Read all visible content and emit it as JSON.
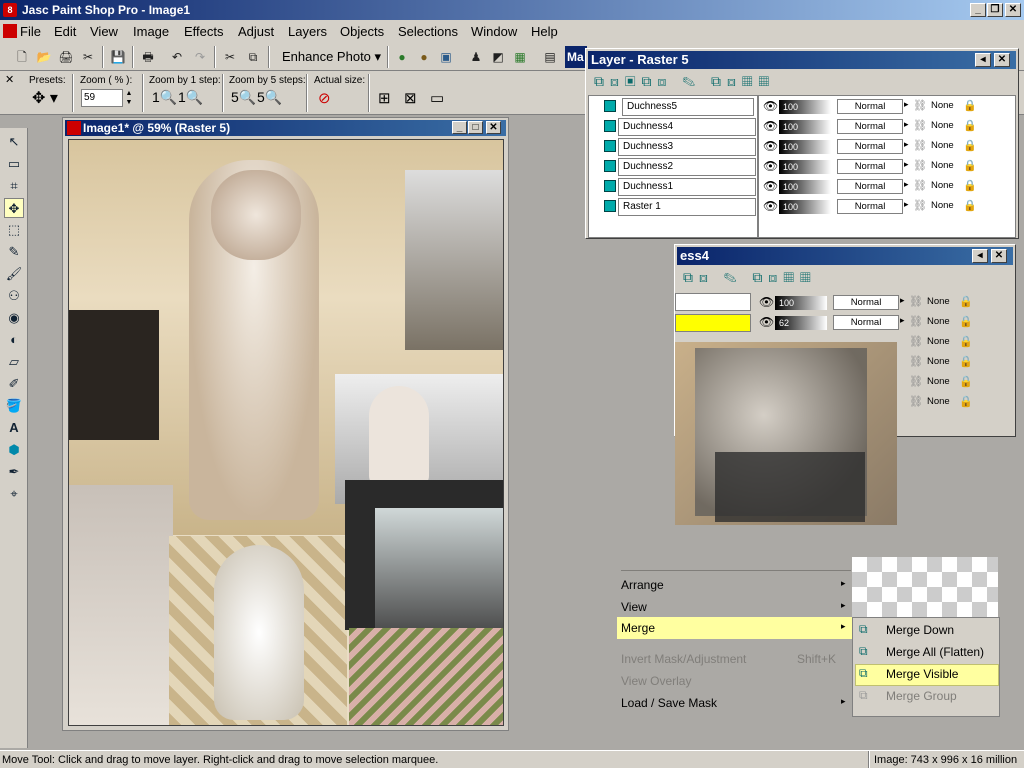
{
  "app": {
    "title": "Jasc Paint Shop Pro - Image1"
  },
  "menubar": [
    "File",
    "Edit",
    "View",
    "Image",
    "Effects",
    "Adjust",
    "Layers",
    "Objects",
    "Selections",
    "Window",
    "Help"
  ],
  "toolbar": {
    "enhance_label": "Enhance Photo"
  },
  "tool_options": {
    "presets_label": "Presets:",
    "zoom_label": "Zoom ( % ):",
    "zoom_value": "59",
    "zoom1_label": "Zoom by 1 step:",
    "zoom5_label": "Zoom by 5 steps:",
    "actual_label": "Actual size:"
  },
  "image_window": {
    "title": "Image1* @ 59% (Raster 5)"
  },
  "layer_palette": {
    "title": "Layer - Raster 5",
    "layers": [
      {
        "name": "Duchness5",
        "opacity": "100",
        "blend": "Normal",
        "mask": "None"
      },
      {
        "name": "Duchness4",
        "opacity": "100",
        "blend": "Normal",
        "mask": "None"
      },
      {
        "name": "Duchness3",
        "opacity": "100",
        "blend": "Normal",
        "mask": "None"
      },
      {
        "name": "Duchness2",
        "opacity": "100",
        "blend": "Normal",
        "mask": "None"
      },
      {
        "name": "Duchness1",
        "opacity": "100",
        "blend": "Normal",
        "mask": "None"
      },
      {
        "name": "Raster 1",
        "opacity": "100",
        "blend": "Normal",
        "mask": "None"
      }
    ]
  },
  "layer_palette2": {
    "title_fragment": "ess4",
    "layers": [
      {
        "opacity": "100",
        "blend": "Normal",
        "mask": "None"
      },
      {
        "opacity": "62",
        "blend": "Normal",
        "mask": "None"
      },
      {
        "mask": "None"
      },
      {
        "mask": "None"
      },
      {
        "mask": "None"
      },
      {
        "mask": "None"
      }
    ]
  },
  "context_menu": {
    "items": [
      {
        "label": "Arrange",
        "disabled": false,
        "submenu": true
      },
      {
        "label": "View",
        "disabled": false,
        "submenu": true
      },
      {
        "label": "Merge",
        "disabled": false,
        "submenu": true,
        "highlighted": true
      },
      {
        "label": "Invert Mask/Adjustment",
        "shortcut": "Shift+K",
        "disabled": true
      },
      {
        "label": "View Overlay",
        "disabled": true
      },
      {
        "label": "Load / Save Mask",
        "disabled": false,
        "submenu": true
      }
    ]
  },
  "merge_submenu": {
    "items": [
      {
        "label": "Merge Down",
        "disabled": false
      },
      {
        "label": "Merge All (Flatten)",
        "disabled": false
      },
      {
        "label": "Merge Visible",
        "disabled": false,
        "highlighted": true
      },
      {
        "label": "Merge Group",
        "disabled": true
      }
    ]
  },
  "status": {
    "left": "Move Tool: Click and drag to move layer. Right-click and drag to move selection marquee.",
    "right": "Image:  743 x 996 x 16 million"
  },
  "colors": {
    "title_start": "#0a246a",
    "title_end": "#a6caf0",
    "highlight": "#ffffa0"
  }
}
